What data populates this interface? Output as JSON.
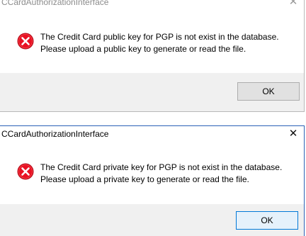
{
  "dialogs": [
    {
      "title": "CCardAuthorizationInterface",
      "close_glyph": "✕",
      "icon": "error-icon",
      "message_line1": "The Credit Card public key for PGP is not exist in the database.",
      "message_line2": "Please upload a public key to generate or read the file.",
      "button_label": "OK",
      "active": false
    },
    {
      "title": "CCardAuthorizationInterface",
      "close_glyph": "✕",
      "icon": "error-icon",
      "message_line1": "The Credit Card private key for PGP is not exist in the database.",
      "message_line2": "Please upload a private key to generate or read the file.",
      "button_label": "OK",
      "active": true
    }
  ],
  "colors": {
    "error_red": "#e81123",
    "footer_bg": "#f0f0f0",
    "active_border": "#2b61b6",
    "button_face": "#e1e1e1"
  }
}
